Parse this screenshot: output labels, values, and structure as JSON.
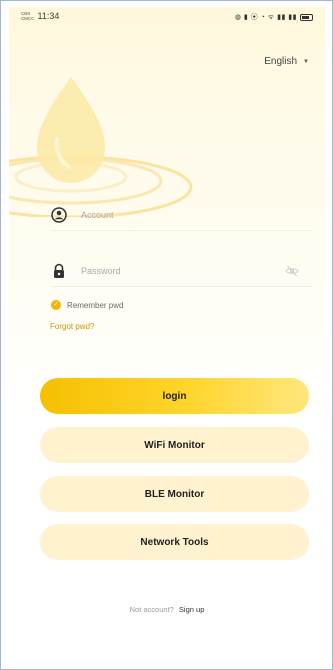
{
  "status_bar": {
    "carrier_top": "CBS",
    "carrier_bottom": "CMCC",
    "time": "11:34",
    "icons_text": "◍ ▮ ⦿ ◔ ᯤ ▮▮ ▮▮",
    "battery": "battery-icon"
  },
  "language": {
    "label": "English",
    "caret": "▼"
  },
  "form": {
    "account_placeholder": "Account",
    "password_placeholder": "Password",
    "remember_label": "Remember pwd",
    "remember_checked": true,
    "forgot_link": "Forgot pwd?"
  },
  "buttons": {
    "login": "login",
    "wifi": "WiFi Monitor",
    "ble": "BLE Monitor",
    "network": "Network Tools"
  },
  "footer": {
    "question": "Not account?",
    "signup": "Sign up"
  },
  "colors": {
    "accent": "#f6c000",
    "secondary_button": "#fff3cf",
    "link": "#c99a00",
    "drop": "#fde9a6"
  }
}
